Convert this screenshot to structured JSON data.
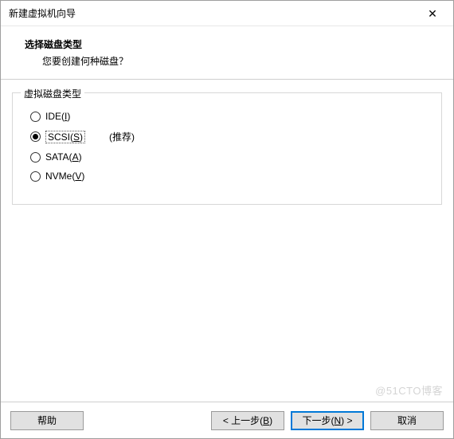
{
  "window": {
    "title": "新建虚拟机向导",
    "close_glyph": "✕"
  },
  "header": {
    "title": "选择磁盘类型",
    "subtitle": "您要创建何种磁盘？"
  },
  "group": {
    "legend": "虚拟磁盘类型",
    "recommended_label": "(推荐)",
    "options": [
      {
        "text": "IDE",
        "accel": "I",
        "checked": false,
        "recommended": false
      },
      {
        "text": "SCSI",
        "accel": "S",
        "checked": true,
        "recommended": true
      },
      {
        "text": "SATA",
        "accel": "A",
        "checked": false,
        "recommended": false
      },
      {
        "text": "NVMe",
        "accel": "V",
        "checked": false,
        "recommended": false
      }
    ]
  },
  "footer": {
    "help": "帮助",
    "back_prefix": "< 上一步(",
    "back_accel": "B",
    "back_suffix": ")",
    "next_prefix": "下一步(",
    "next_accel": "N",
    "next_suffix": ") >",
    "cancel": "取消"
  },
  "watermark": "@51CTO博客"
}
